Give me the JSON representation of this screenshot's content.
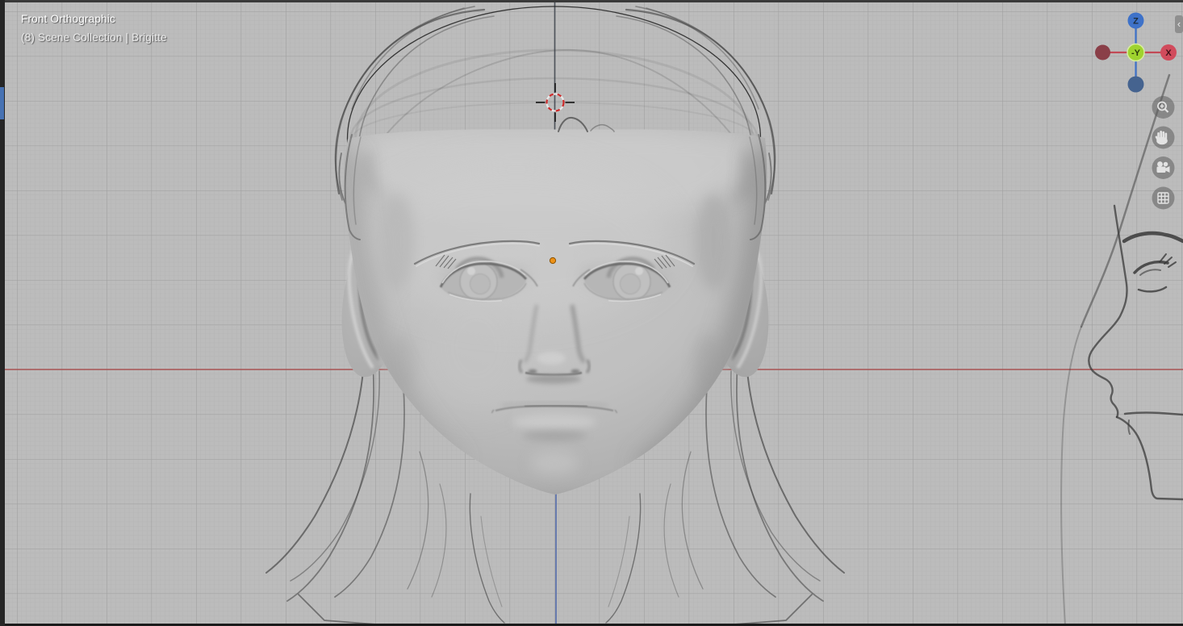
{
  "viewport": {
    "view_label": "Front Orthographic",
    "collection_label": "(8) Scene Collection | Brigitte",
    "object_name": "Brigitte"
  },
  "gizmo": {
    "axis_z_label": "Z",
    "axis_neg_y_label": "-Y",
    "axis_x_label": "X",
    "color_x": "#d14b5c",
    "color_neg_x": "#8a3f48",
    "color_z": "#3e72c9",
    "color_neg_z": "#45638f",
    "color_neg_y": "#9fd32e"
  },
  "axes": {
    "x_axis_color": "#a84a4a",
    "z_axis_color": "#5f74ad"
  },
  "origin_dot_color": "#ed9116",
  "sidebar_toggle_label": "‹",
  "toolbar_icons": [
    "zoom",
    "pan",
    "camera-view",
    "toggle-projection"
  ]
}
